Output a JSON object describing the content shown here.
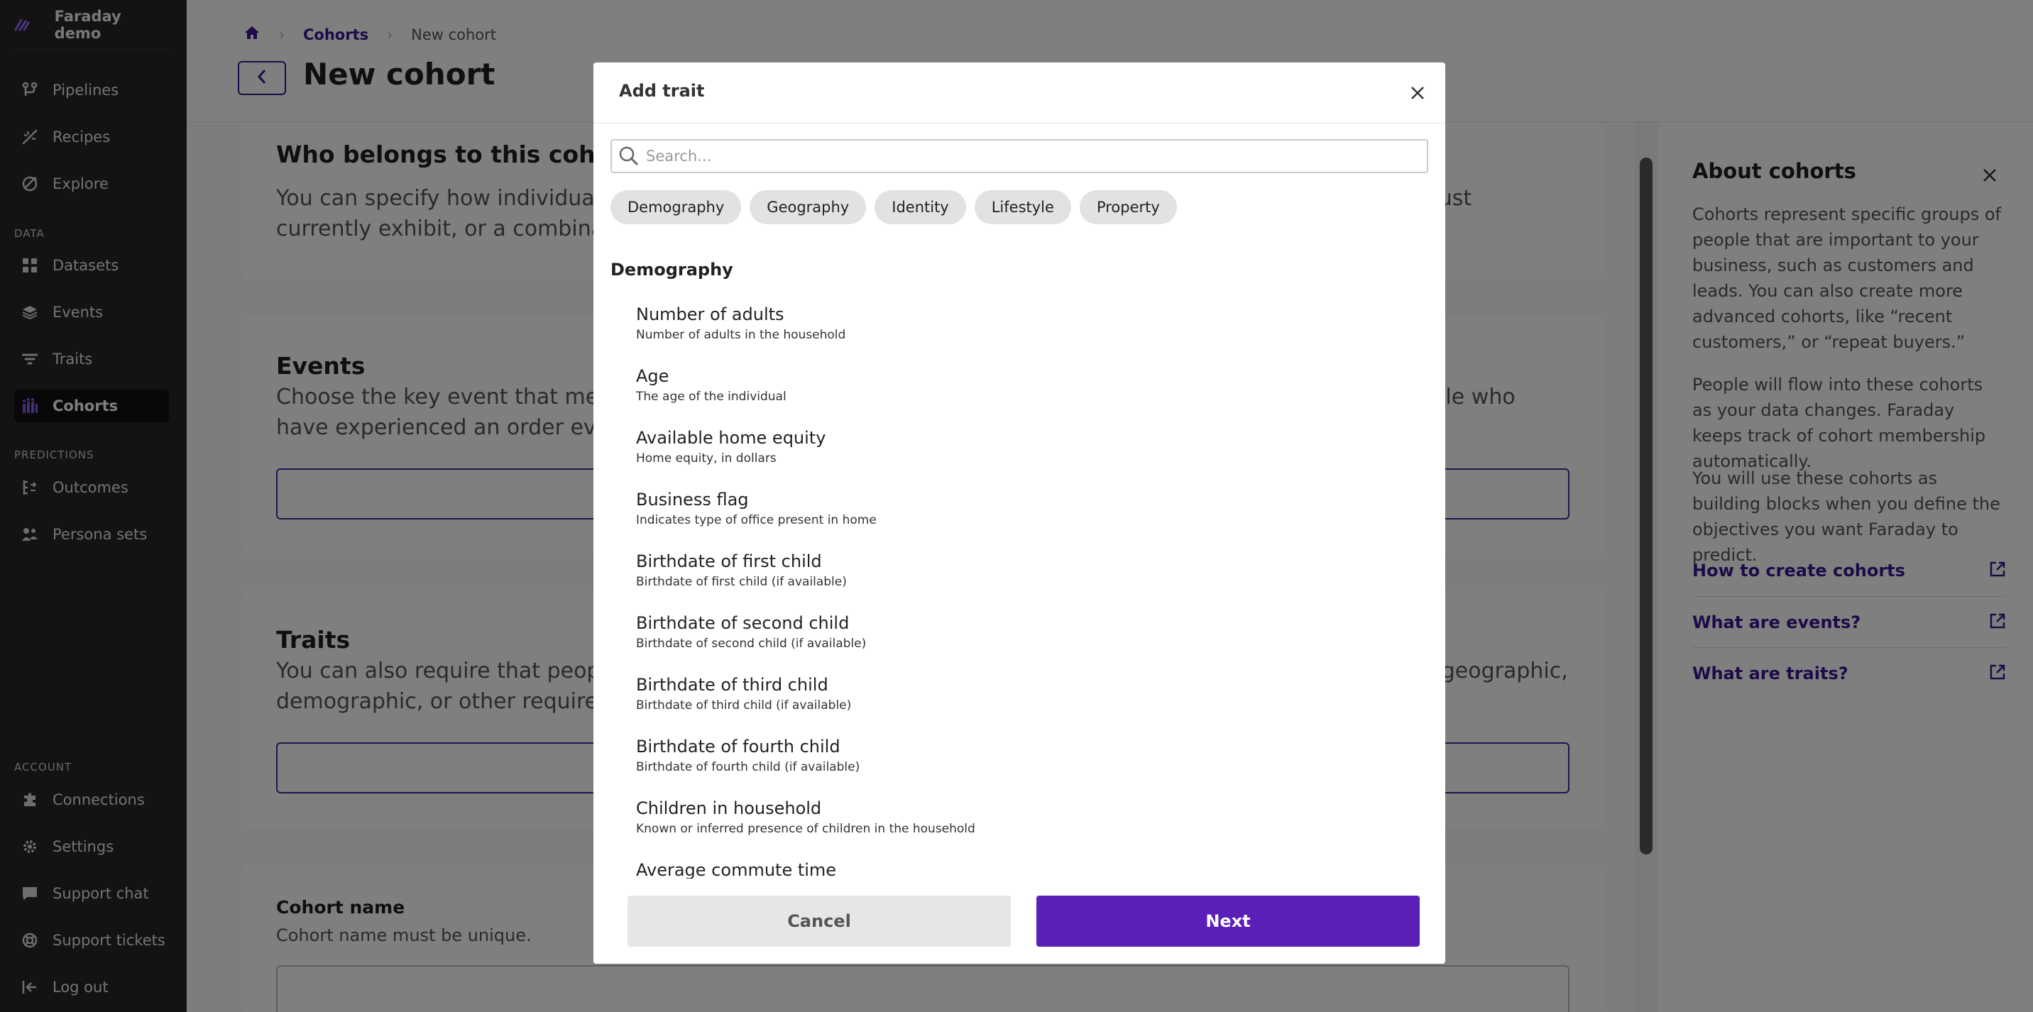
{
  "app": {
    "brand": "Faraday demo"
  },
  "sidebar": {
    "items": [
      {
        "label": "Pipelines",
        "icon": "pipelines-icon"
      },
      {
        "label": "Recipes",
        "icon": "recipes-icon"
      },
      {
        "label": "Explore",
        "icon": "explore-icon"
      }
    ],
    "data_section": "DATA",
    "data_items": [
      {
        "label": "Datasets",
        "icon": "datasets-icon"
      },
      {
        "label": "Events",
        "icon": "events-icon"
      },
      {
        "label": "Traits",
        "icon": "traits-icon"
      },
      {
        "label": "Cohorts",
        "icon": "cohorts-icon",
        "active": true
      }
    ],
    "predictions_section": "PREDICTIONS",
    "prediction_items": [
      {
        "label": "Outcomes",
        "icon": "outcomes-icon"
      },
      {
        "label": "Persona sets",
        "icon": "persona-sets-icon"
      }
    ],
    "account_section": "ACCOUNT",
    "account_items": [
      {
        "label": "Connections",
        "icon": "connections-icon"
      },
      {
        "label": "Settings",
        "icon": "settings-icon"
      },
      {
        "label": "Support chat",
        "icon": "support-chat-icon"
      },
      {
        "label": "Support tickets",
        "icon": "support-tickets-icon"
      },
      {
        "label": "Log out",
        "icon": "log-out-icon"
      }
    ]
  },
  "breadcrumb": {
    "cohorts": "Cohorts",
    "current": "New cohort"
  },
  "page": {
    "title": "New cohort"
  },
  "cards": {
    "who": {
      "title": "Who belongs to this cohort?",
      "desc": "You can specify how individuals can join this cohort by the events they must have experienced, traits they must currently exhibit, or a combination of both."
    },
    "events": {
      "title": "Events",
      "desc": "Choose the key event that members of this cohort have experienced. For example, define customers as people who have experienced an order event."
    },
    "traits": {
      "title": "Traits",
      "desc": "You can also require that people currently exhibit certain traits to be in this cohort. For example, you can set geographic, demographic, or other requirements."
    },
    "name": {
      "title": "Cohort name",
      "desc": "Cohort name must be unique."
    }
  },
  "about": {
    "title": "About cohorts",
    "paragraphs": [
      "Cohorts represent specific groups of people that are important to your business, such as customers and leads. You can also create more advanced cohorts, like “recent customers,” or “repeat buyers.”",
      "People will flow into these cohorts as your data changes. Faraday keeps track of cohort membership automatically.",
      "You will use these cohorts as building blocks when you define the objectives you want Faraday to predict."
    ],
    "links": [
      "How to create cohorts",
      "What are events?",
      "What are traits?"
    ]
  },
  "modal": {
    "title": "Add trait",
    "search_placeholder": "Search...",
    "chips": [
      "Demography",
      "Geography",
      "Identity",
      "Lifestyle",
      "Property"
    ],
    "group_title": "Demography",
    "traits": [
      {
        "name": "Number of adults",
        "desc": "Number of adults in the household"
      },
      {
        "name": "Age",
        "desc": "The age of the individual"
      },
      {
        "name": "Available home equity",
        "desc": "Home equity, in dollars"
      },
      {
        "name": "Business flag",
        "desc": "Indicates type of office present in home"
      },
      {
        "name": "Birthdate of first child",
        "desc": "Birthdate of first child (if available)"
      },
      {
        "name": "Birthdate of second child",
        "desc": "Birthdate of second child (if available)"
      },
      {
        "name": "Birthdate of third child",
        "desc": "Birthdate of third child (if available)"
      },
      {
        "name": "Birthdate of fourth child",
        "desc": "Birthdate of fourth child (if available)"
      },
      {
        "name": "Children in household",
        "desc": "Known or inferred presence of children in the household"
      },
      {
        "name": "Average commute time",
        "desc": ""
      }
    ],
    "cancel_label": "Cancel",
    "next_label": "Next"
  },
  "colors": {
    "accent": "#5b1fb8",
    "link": "#3d1491",
    "sidebar_bg": "#262626"
  }
}
